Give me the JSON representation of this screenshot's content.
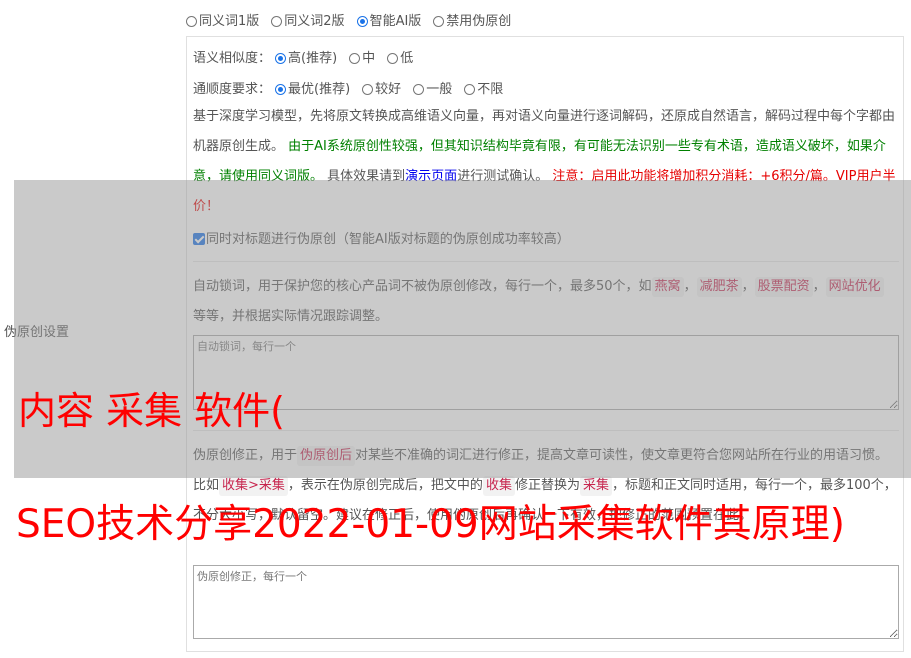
{
  "modes": {
    "options": [
      {
        "label": "同义词1版",
        "checked": false
      },
      {
        "label": "同义词2版",
        "checked": false
      },
      {
        "label": "智能AI版",
        "checked": true
      },
      {
        "label": "禁用伪原创",
        "checked": false
      }
    ]
  },
  "side_label": "伪原创设置",
  "similarity": {
    "label": "语义相似度：",
    "options": [
      {
        "label": "高(推荐)",
        "checked": true
      },
      {
        "label": "中",
        "checked": false
      },
      {
        "label": "低",
        "checked": false
      }
    ]
  },
  "fluency": {
    "label": "通顺度要求：",
    "options": [
      {
        "label": "最优(推荐)",
        "checked": true
      },
      {
        "label": "较好",
        "checked": false
      },
      {
        "label": "一般",
        "checked": false
      },
      {
        "label": "不限",
        "checked": false
      }
    ]
  },
  "ai_desc": {
    "part1": "基于深度学习模型，先将原文转换成高维语义向量，再对语义向量进行逐词解码，还原成自然语言，解码过程中每个字都由机器原创生成。",
    "part2_green": "由于AI系统原创性较强，但其知识结构毕竟有限，有可能无法识别一些专有术语，造成语义破坏，如果介意，请使用同义词版。",
    "part3": "具体效果请到",
    "demo_link": "演示页面",
    "part4": "进行测试确认。",
    "part5_red": "注意：启用此功能将增加积分消耗：+6积分/篇。VIP用户半价！"
  },
  "title_checkbox": {
    "checked": true,
    "label": "同时对标题进行伪原创（智能AI版对标题的伪原创成功率较高）"
  },
  "lock_words": {
    "desc_before": "自动锁词，用于保护您的核心产品词不被伪原创修改，每行一个，最多50个，如",
    "examples": [
      "燕窝",
      "减肥茶",
      "股票配资",
      "网站优化"
    ],
    "desc_after": "等等，并根据实际情况跟踪调整。",
    "placeholder": "自动锁词，每行一个"
  },
  "correction": {
    "desc1": "伪原创修正，用于",
    "tag1": "伪原创后",
    "desc2": "对某些不准确的词汇进行修正，提高文章可读性，使文章更符合您网站所在行业的用语习惯。比如",
    "tag2": "收集>采集",
    "desc3": "，表示在伪原创完成后，把文中的",
    "tag3": "收集",
    "desc4": "修正替换为",
    "tag4": "采集",
    "desc5": "，标题和正文同时适用，每行一个，最多100个，不分大小写，默认留空。建议在修正后，使用伪原创后再确认一下有效，把修正的范围预置在此。",
    "placeholder": "伪原创修正，每行一个"
  },
  "watermark": {
    "line1": "内容 采集 软件(",
    "line2": "SEO技术分享2022-01-09网站采集软件其原理)"
  },
  "colors": {
    "accent": "#1a73e8",
    "green": "#008000",
    "red": "#e60000",
    "link": "#0000ee"
  }
}
